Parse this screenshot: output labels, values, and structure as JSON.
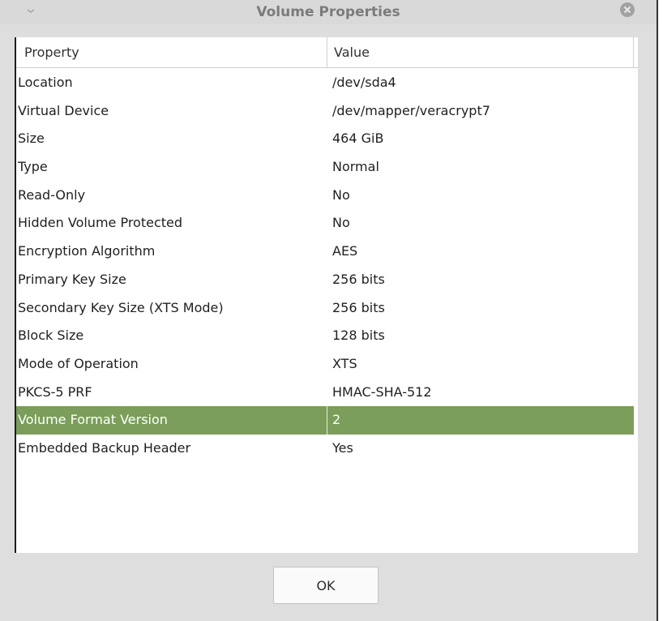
{
  "window": {
    "title": "Volume Properties"
  },
  "table": {
    "headers": [
      "Property",
      "Value"
    ],
    "selected_index": 13,
    "selection_color": "#7b9e5a",
    "rows": [
      {
        "property": "Location",
        "value": "/dev/sda4"
      },
      {
        "property": "Virtual Device",
        "value": "/dev/mapper/veracrypt7"
      },
      {
        "property": "Size",
        "value": "464 GiB"
      },
      {
        "property": "Type",
        "value": "Normal"
      },
      {
        "property": "Read-Only",
        "value": "No"
      },
      {
        "property": "Hidden Volume Protected",
        "value": "No"
      },
      {
        "property": "Encryption Algorithm",
        "value": "AES"
      },
      {
        "property": "Primary Key Size",
        "value": "256 bits"
      },
      {
        "property": "Secondary Key Size (XTS Mode)",
        "value": "256 bits"
      },
      {
        "property": "Block Size",
        "value": "128 bits"
      },
      {
        "property": "Mode of Operation",
        "value": "XTS"
      },
      {
        "property": "PKCS-5 PRF",
        "value": "HMAC-SHA-512"
      },
      {
        "property": "Volume Format Version",
        "value": "2"
      },
      {
        "property": "Embedded Backup Header",
        "value": "Yes"
      }
    ]
  },
  "footer": {
    "ok_label": "OK"
  },
  "icons": {
    "menu": "chevron-down-icon",
    "close": "close-icon"
  }
}
